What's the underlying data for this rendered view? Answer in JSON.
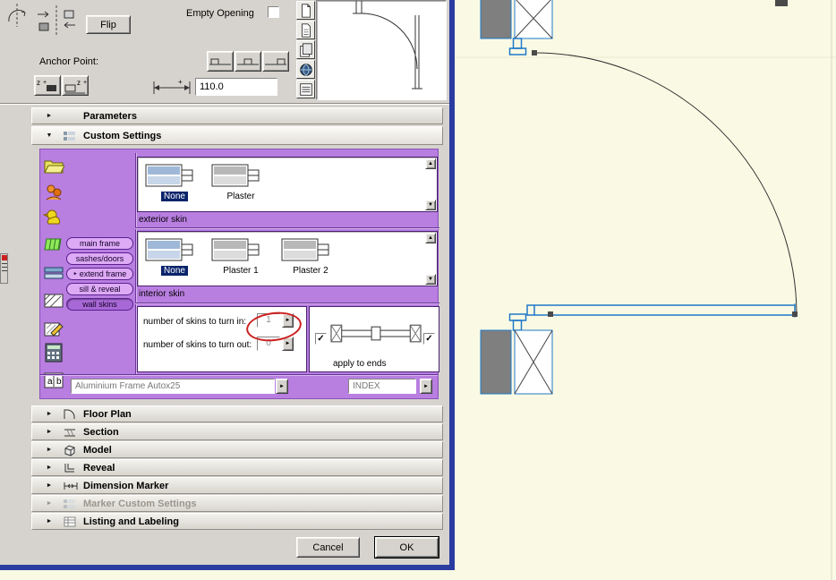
{
  "dialog": {
    "top": {
      "flip_button": "Flip",
      "empty_opening_label": "Empty Opening",
      "anchor_point_label": "Anchor Point:",
      "width_value": "110.0"
    },
    "sections": {
      "parameters": "Parameters",
      "custom_settings": "Custom Settings",
      "floor_plan": "Floor Plan",
      "section": "Section",
      "model": "Model",
      "reveal": "Reveal",
      "dimension_marker": "Dimension Marker",
      "marker_custom_settings": "Marker Custom Settings",
      "listing_and_labeling": "Listing and Labeling"
    },
    "panel": {
      "tabs": [
        {
          "label": "main frame"
        },
        {
          "label": "sashes/doors"
        },
        {
          "label": "extend frame"
        },
        {
          "label": "sill & reveal"
        },
        {
          "label": "wall skins"
        }
      ],
      "selected_tab": "wall skins",
      "exterior_skin": {
        "label": "exterior skin",
        "items": [
          "None",
          "Plaster"
        ],
        "selected": "None"
      },
      "interior_skin": {
        "label": "interior skin",
        "items": [
          "None",
          "Plaster 1",
          "Plaster 2"
        ],
        "selected": "None"
      },
      "turn_in": {
        "label": "number of skins to turn in:",
        "value": "1"
      },
      "turn_out": {
        "label": "number of skins to turn out:",
        "value": "0"
      },
      "apply_to_ends_label": "apply to ends",
      "name_field": "Aluminium Frame Autox25",
      "index_field": "INDEX"
    },
    "footer": {
      "cancel": "Cancel",
      "ok": "OK"
    }
  },
  "icons": {
    "tri_right": "►",
    "tri_down": "▼",
    "arrow_up": "▲",
    "arrow_down": "▼",
    "check": "✓"
  },
  "colors": {
    "panel_purple": "#B87EE0",
    "tab_purple": "#DDAAF5",
    "selection_blue": "#0A246A",
    "canvas_cream": "#FAFAE4",
    "drawing_blue": "#1E78C8",
    "annotation_red": "#CC2020",
    "window_border_blue": "#2B3CA0"
  }
}
